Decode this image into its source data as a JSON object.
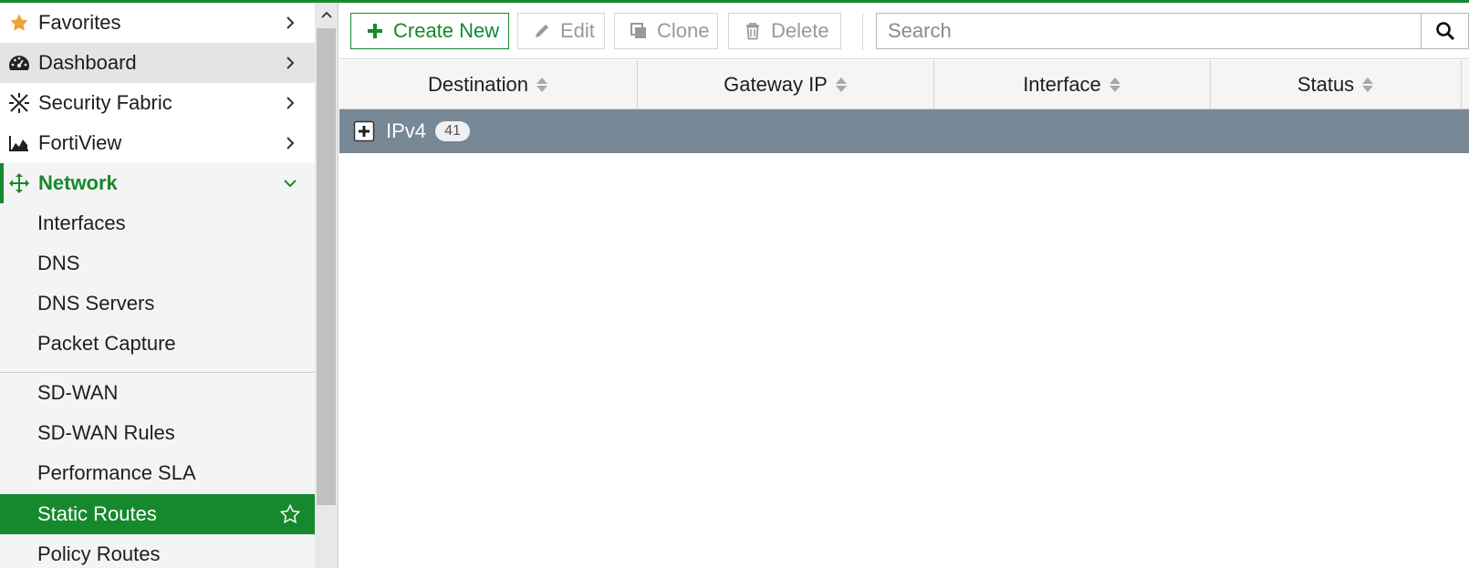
{
  "colors": {
    "accent": "#16892d",
    "group_row": "#778897",
    "sidebar_bg": "#f4f4f4"
  },
  "sidebar": {
    "items": [
      {
        "label": "Favorites",
        "icon": "star-icon"
      },
      {
        "label": "Dashboard",
        "icon": "dashboard-gauge-icon"
      },
      {
        "label": "Security Fabric",
        "icon": "security-fabric-icon"
      },
      {
        "label": "FortiView",
        "icon": "area-chart-icon"
      },
      {
        "label": "Network",
        "icon": "network-arrows-icon"
      }
    ],
    "network_subitems": [
      {
        "label": "Interfaces"
      },
      {
        "label": "DNS"
      },
      {
        "label": "DNS Servers"
      },
      {
        "label": "Packet Capture"
      },
      {
        "label": "SD-WAN"
      },
      {
        "label": "SD-WAN Rules"
      },
      {
        "label": "Performance SLA"
      },
      {
        "label": "Static Routes"
      },
      {
        "label": "Policy Routes"
      }
    ],
    "active_item": "Static Routes"
  },
  "toolbar": {
    "create_new_label": "Create New",
    "edit_label": "Edit",
    "clone_label": "Clone",
    "delete_label": "Delete"
  },
  "search": {
    "placeholder": "Search"
  },
  "table": {
    "columns": [
      "Destination",
      "Gateway IP",
      "Interface",
      "Status"
    ],
    "groups": [
      {
        "label": "IPv4",
        "count": "41"
      }
    ]
  }
}
